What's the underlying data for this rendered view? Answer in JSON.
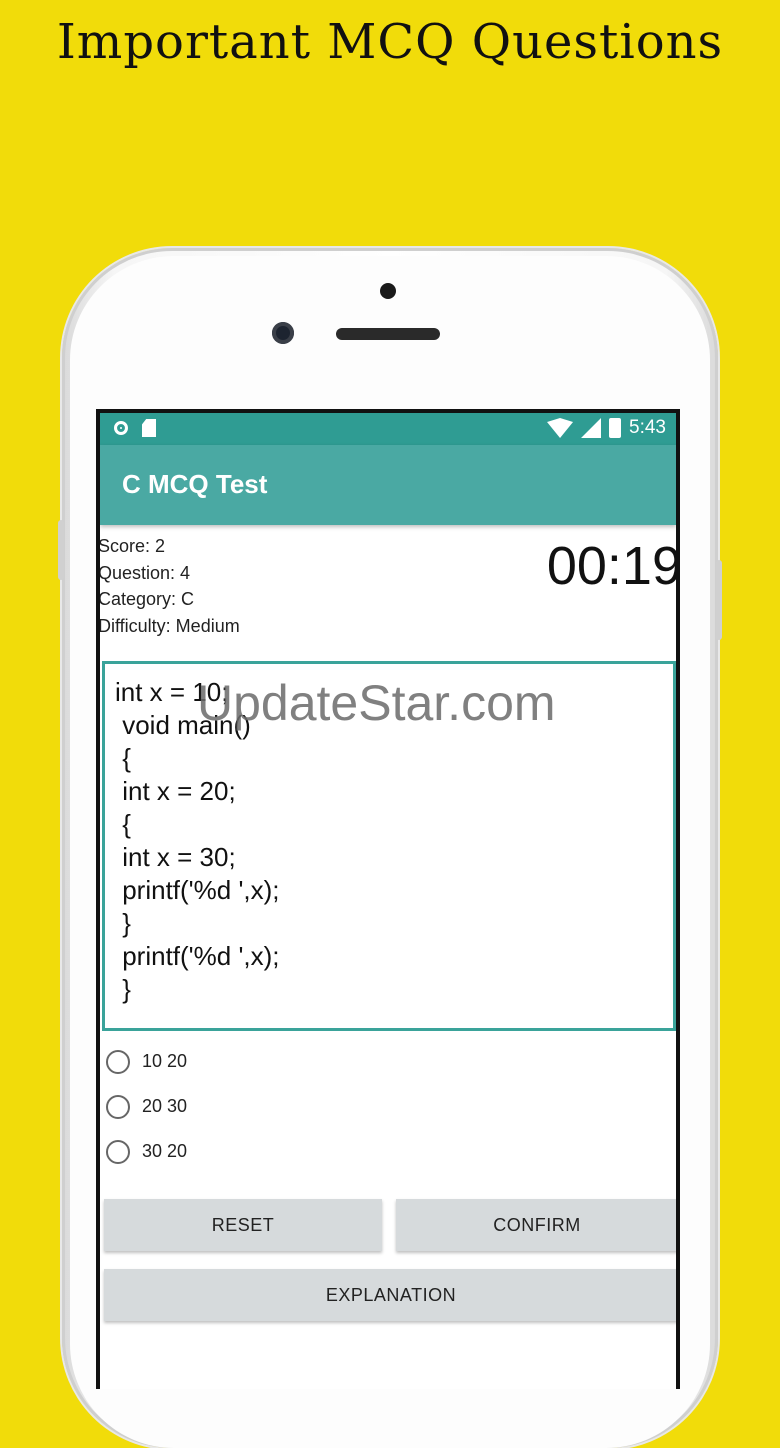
{
  "promo": {
    "title": "Important MCQ Questions"
  },
  "status_bar": {
    "time": "5:43"
  },
  "app_bar": {
    "title": "C MCQ Test"
  },
  "info": {
    "score": "Score: 2",
    "question": "Question: 4",
    "category": "Category: C",
    "difficulty": "Difficulty: Medium"
  },
  "timer": "00:19",
  "question": {
    "code_lines": [
      "int x = 10;",
      " void main()",
      " {",
      " int x = 20;",
      " {",
      " int x = 30;",
      " printf('%d ',x);",
      " }",
      " printf('%d ',x);",
      " }"
    ]
  },
  "watermark": "UpdateStar.com",
  "options": [
    {
      "label": "10 20"
    },
    {
      "label": "20 30"
    },
    {
      "label": "30 20"
    }
  ],
  "buttons": {
    "reset": "RESET",
    "confirm": "CONFIRM",
    "explanation": "EXPLANATION"
  },
  "colors": {
    "background": "#f1dc0a",
    "status_bar": "#2f9c93",
    "app_bar": "#4aa9a3",
    "accent": "#3aa39a",
    "button": "#d6dadc"
  }
}
